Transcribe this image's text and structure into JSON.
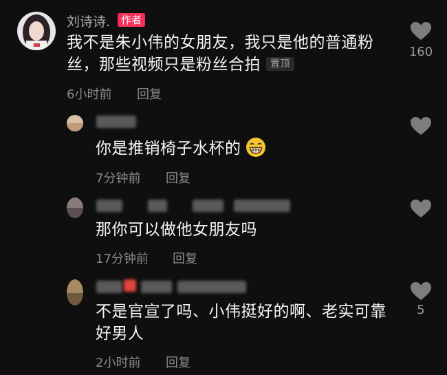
{
  "comments": [
    {
      "author": "刘诗诗.",
      "author_tag": "作者",
      "text_line1": "我不是朱小伟的女朋友，我只是他的普通粉",
      "text_line2": "丝，那些视频只是粉丝合拍",
      "pinned_tag": "置顶",
      "time": "6小时前",
      "reply_label": "回复",
      "likes": "160"
    },
    {
      "text": "你是推销椅子水杯的",
      "emoji": "grinning-emoji",
      "time": "7分钟前",
      "reply_label": "回复"
    },
    {
      "text": "那你可以做他女朋友吗",
      "time": "17分钟前",
      "reply_label": "回复"
    },
    {
      "text_line1": "不是官宣了吗、小伟挺好的啊、老实可靠",
      "text_line2": "好男人",
      "time": "2小时前",
      "reply_label": "回复",
      "likes": "5"
    }
  ],
  "icons": {
    "like": "heart-icon"
  },
  "colors": {
    "background": "#0f0f0f",
    "author_tag": "#f2305a",
    "like_icon": "#7d7d7d"
  }
}
